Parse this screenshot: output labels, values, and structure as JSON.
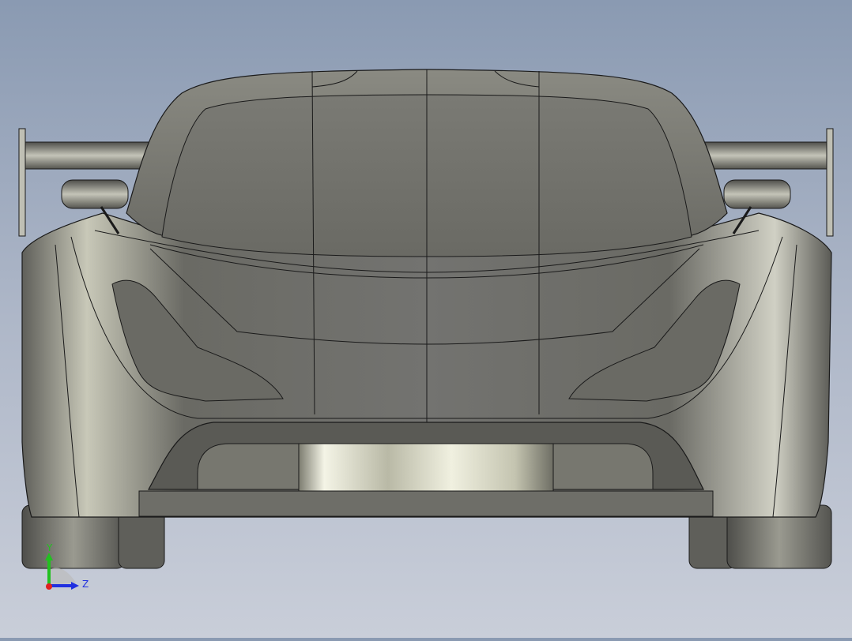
{
  "viewport": {
    "background_top": "#8a9ab2",
    "background_bottom": "#c9ced9",
    "model_color": "#6e6e68"
  },
  "triad": {
    "y_label": "Y",
    "z_label": "Z",
    "y_color": "#22c020",
    "z_color": "#2030e0",
    "x_color": "#e02020"
  }
}
